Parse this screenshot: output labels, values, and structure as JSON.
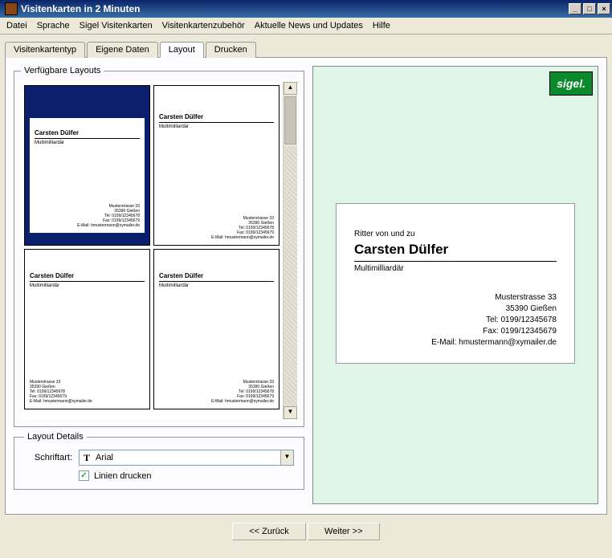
{
  "window": {
    "title": "Visitenkarten in 2 Minuten"
  },
  "menubar": [
    "Datei",
    "Sprache",
    "Sigel Visitenkarten",
    "Visitenkartenzubehör",
    "Aktuelle News und Updates",
    "Hilfe"
  ],
  "tabs": [
    "Visitenkartentyp",
    "Eigene Daten",
    "Layout",
    "Drucken"
  ],
  "activeTab": 2,
  "layouts": {
    "legend": "Verfügbare Layouts",
    "items": [
      {
        "selected": true
      },
      {
        "selected": false
      },
      {
        "selected": false
      },
      {
        "selected": false
      }
    ]
  },
  "thumbCard": {
    "name": "Carsten Dülfer",
    "subtitle": "Multimilliardär"
  },
  "details": {
    "legend": "Layout Details",
    "fontLabel": "Schriftart:",
    "fontIcon": "T",
    "fontName": "Arial",
    "printLines": "Linien drucken",
    "printLinesChecked": true
  },
  "preview": {
    "brand": "sigel.",
    "ritter": "Ritter von und zu",
    "name": "Carsten Dülfer",
    "subtitle": "Multimilliardär",
    "address": {
      "street": "Musterstrasse 33",
      "city": "35390 Gießen",
      "tel": "Tel: 0199/12345678",
      "fax": "Fax: 0199/12345679",
      "email": "E-Mail: hmustermann@xymailer.de"
    }
  },
  "wizard": {
    "back": "<< Zurück",
    "next": "Weiter >>"
  }
}
